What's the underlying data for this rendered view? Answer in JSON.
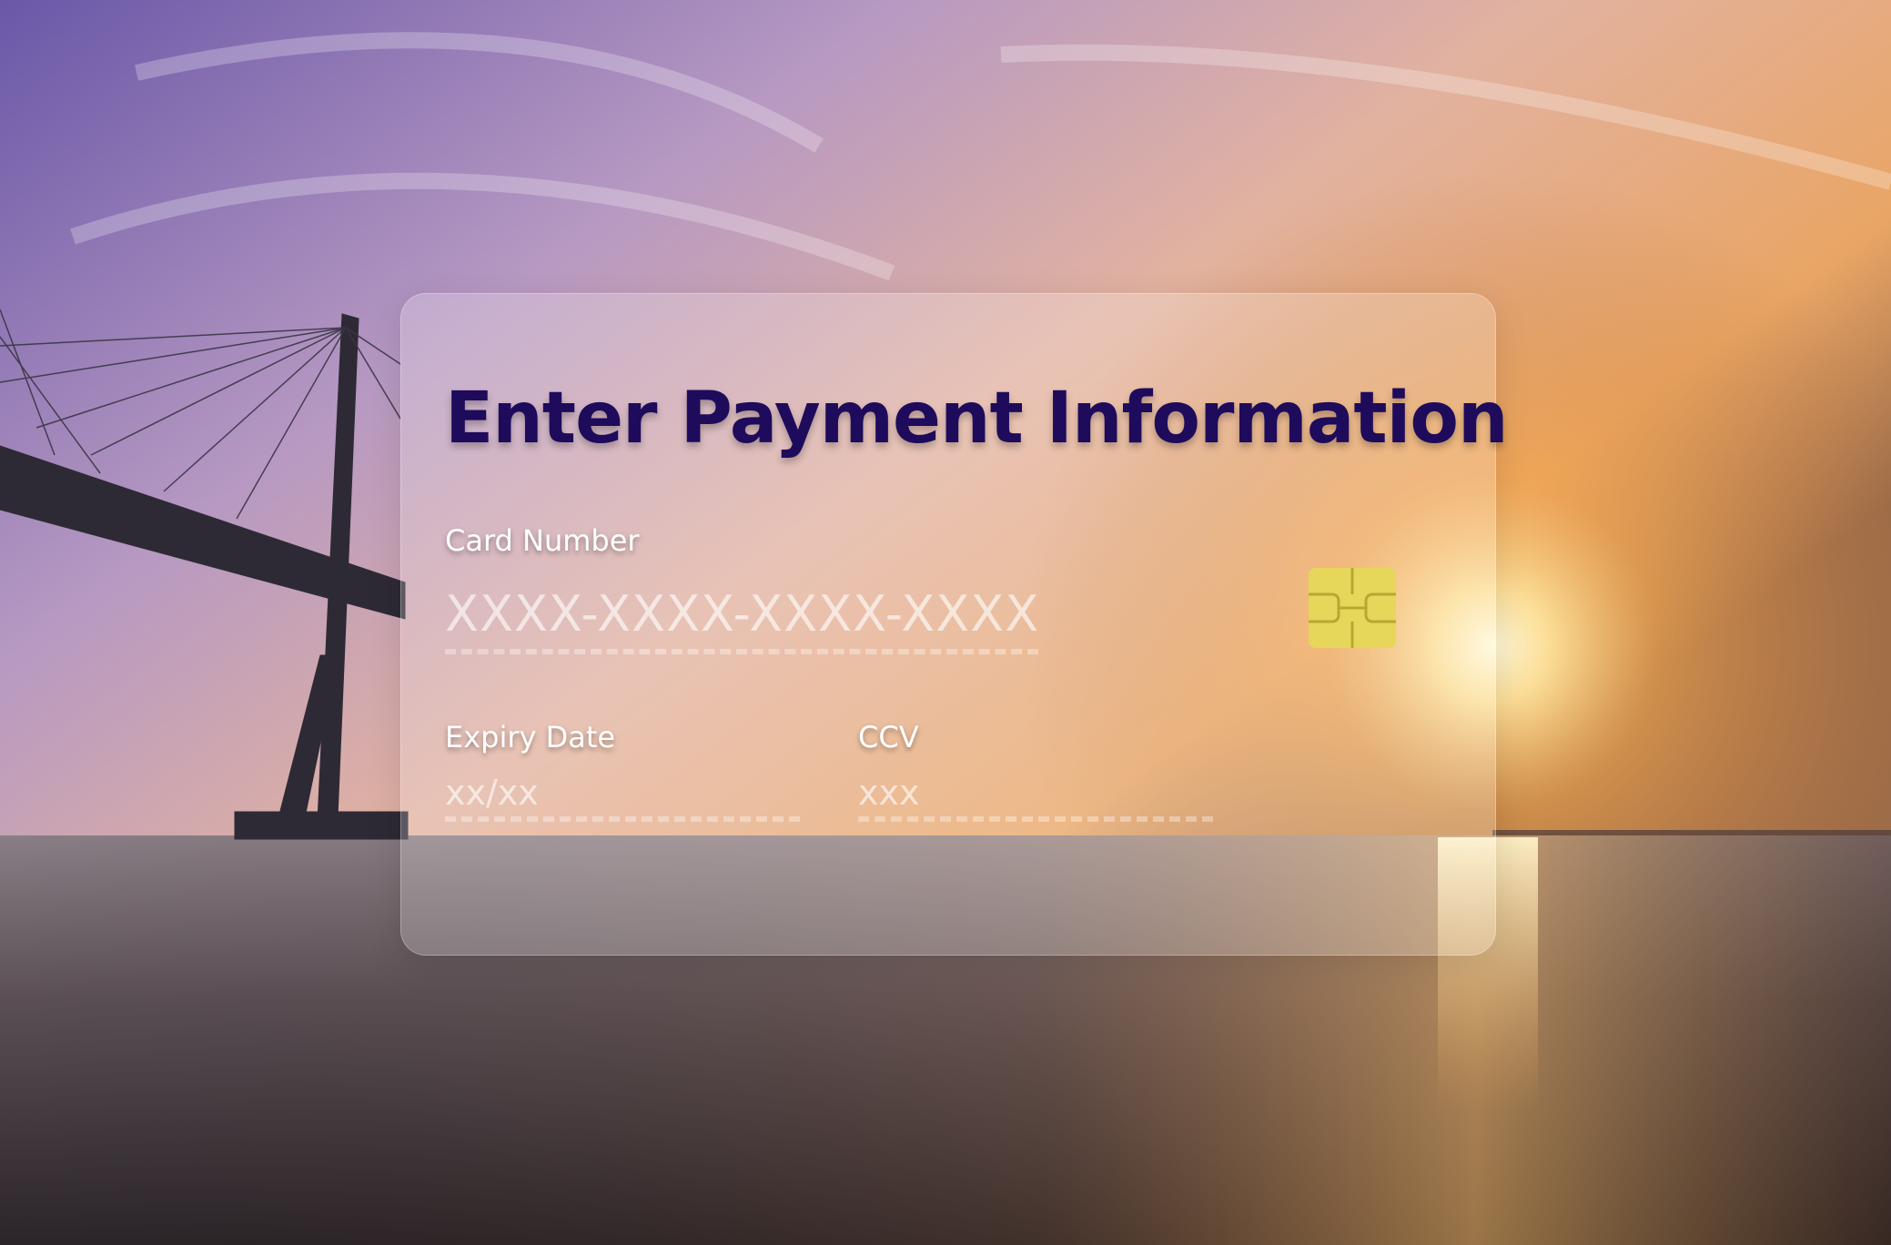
{
  "payment_form": {
    "title": "Enter Payment Information",
    "card_number": {
      "label": "Card Number",
      "placeholder": "XXXX-XXXX-XXXX-XXXX",
      "value": ""
    },
    "expiry_date": {
      "label": "Expiry Date",
      "placeholder": "xx/xx",
      "value": ""
    },
    "ccv": {
      "label": "CCV",
      "placeholder": "xxx",
      "value": ""
    },
    "chip_icon": "card-chip-icon"
  },
  "colors": {
    "title": "#1e0b5c",
    "label": "#ffffff",
    "chip": "#e6d65a",
    "card_glass": "rgba(255,255,255,0.22)"
  }
}
